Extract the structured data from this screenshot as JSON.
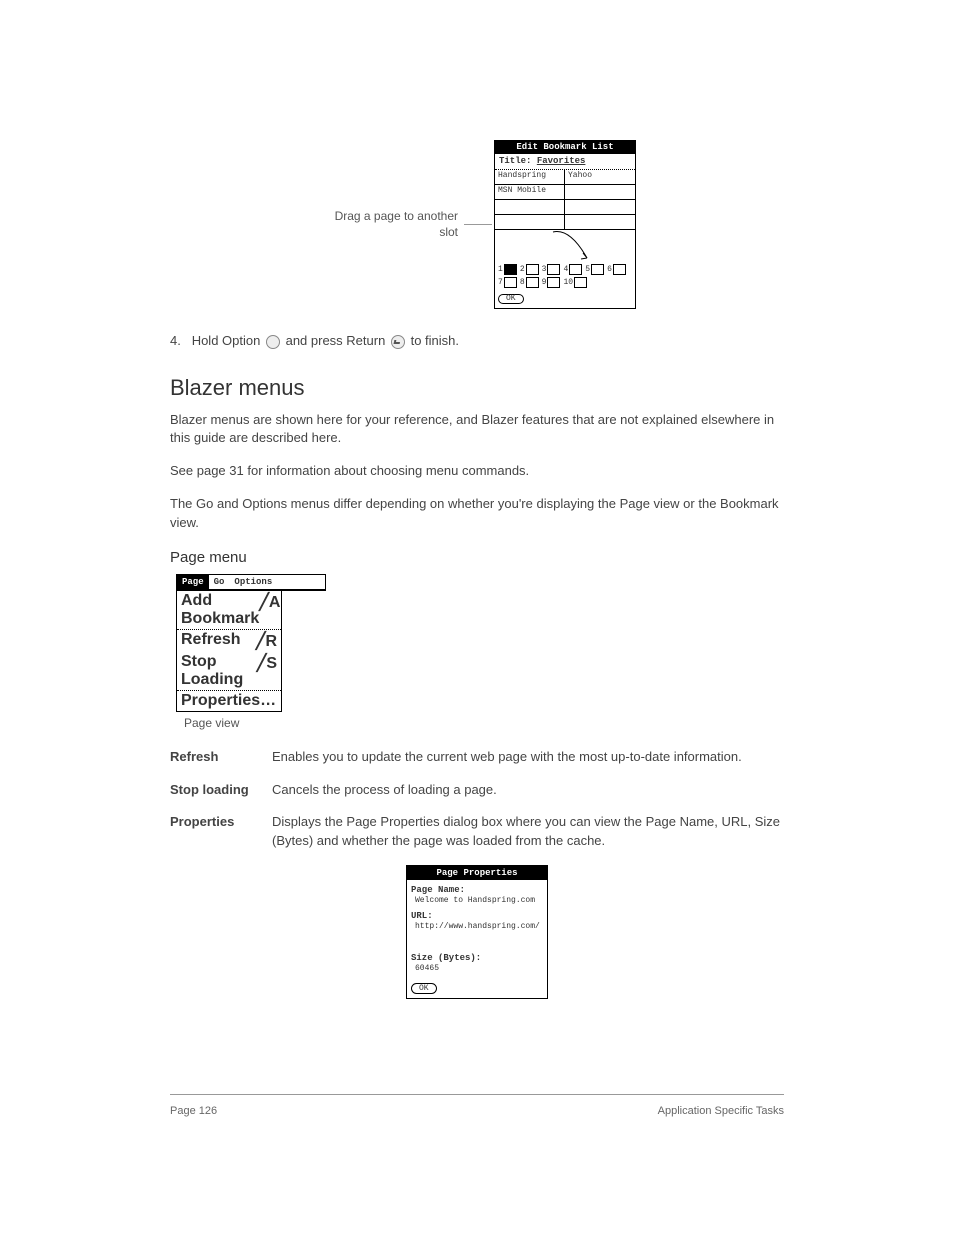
{
  "callout1": "Drag a page to another slot",
  "ebl": {
    "title": "Edit Bookmark List",
    "subtitle_prefix": "Title: ",
    "subtitle_value": "Favorites",
    "cells": [
      "Handspring",
      "Yahoo",
      "MSN Mobile",
      ""
    ],
    "pages": [
      "1",
      "2",
      "3",
      "4",
      "5",
      "6",
      "7",
      "8",
      "9",
      "10"
    ],
    "ok": "OK"
  },
  "step4": {
    "num": "4.",
    "text_a": "Hold Option",
    "text_b": "and press Return",
    "text_c": "to finish."
  },
  "h_blazer": "Blazer menus",
  "p1": "Blazer menus are shown here for your reference, and Blazer features that are not explained elsewhere in this guide are described here.",
  "p2": "See page 31 for information about choosing menu commands.",
  "p3": "The Go and Options menus differ depending on whether you're displaying the Page view or the Bookmark view.",
  "h_pagemenu": "Page menu",
  "menu": {
    "tabs": [
      "Page",
      "Go",
      "Options"
    ],
    "items": [
      {
        "label": "Add Bookmark",
        "shortcut": "╱A"
      },
      {
        "label": "Refresh",
        "shortcut": "╱R"
      },
      {
        "label": "Stop Loading",
        "shortcut": "╱S"
      },
      {
        "label": "Properties…",
        "shortcut": ""
      }
    ],
    "caption": "Page view"
  },
  "defs": [
    {
      "term": "Refresh",
      "desc": "Enables you to update the current web page with the most up-to-date information."
    },
    {
      "term": "Stop loading",
      "desc": "Cancels the process of loading a page."
    },
    {
      "term": "Properties",
      "desc": "Displays the Page Properties dialog box where you can view the Page Name, URL, Size (Bytes) and whether the page was loaded from the cache."
    }
  ],
  "pp": {
    "title": "Page Properties",
    "name_label": "Page Name:",
    "name_value": "Welcome to Handspring.com",
    "url_label": "URL:",
    "url_value": "http://www.handspring.com/",
    "size_label": "Size (Bytes):",
    "size_value": "60465",
    "ok": "OK"
  },
  "footer": {
    "left": "Page 126",
    "right": "Application Specific Tasks"
  }
}
